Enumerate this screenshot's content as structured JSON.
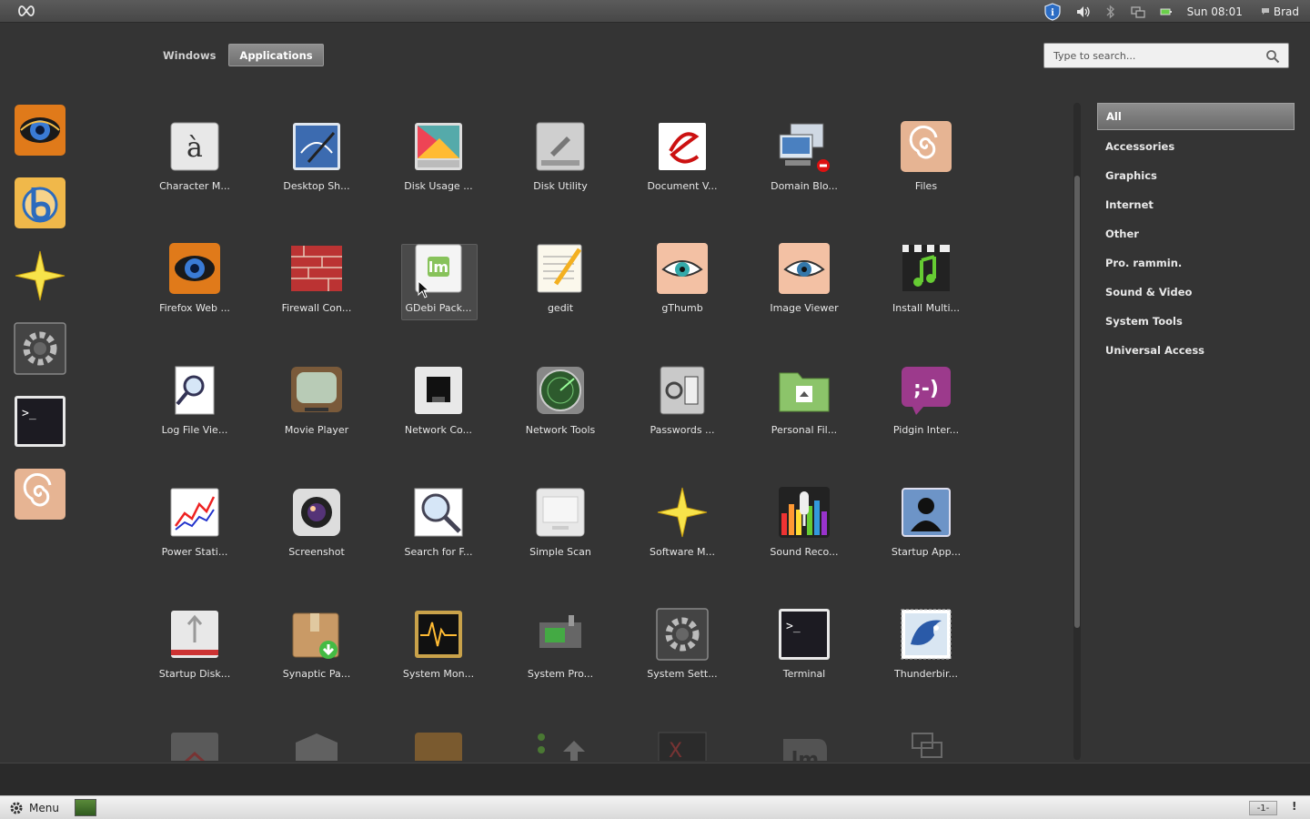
{
  "topbar": {
    "clock": "Sun 08:01",
    "user": "Brad"
  },
  "tabs": [
    {
      "label": "Windows",
      "active": false
    },
    {
      "label": "Applications",
      "active": true
    }
  ],
  "search": {
    "placeholder": "Type to search..."
  },
  "favorites": [
    "firefox-icon",
    "bittorrent-icon",
    "software-manager-icon",
    "system-settings-icon",
    "terminal-icon",
    "files-icon"
  ],
  "apps": [
    {
      "label": "Character M...",
      "icon": "character-map-icon"
    },
    {
      "label": "Desktop Sh...",
      "icon": "desktop-sharing-icon"
    },
    {
      "label": "Disk Usage ...",
      "icon": "disk-usage-icon"
    },
    {
      "label": "Disk Utility",
      "icon": "disk-utility-icon"
    },
    {
      "label": "Document V...",
      "icon": "document-viewer-icon"
    },
    {
      "label": "Domain Blo...",
      "icon": "domain-blocker-icon"
    },
    {
      "label": "Files",
      "icon": "files-icon"
    },
    {
      "label": "Firefox Web ...",
      "icon": "firefox-icon"
    },
    {
      "label": "Firewall Con...",
      "icon": "firewall-icon"
    },
    {
      "label": "GDebi Pack...",
      "icon": "gdebi-icon"
    },
    {
      "label": "gedit",
      "icon": "gedit-icon"
    },
    {
      "label": "gThumb",
      "icon": "gthumb-icon"
    },
    {
      "label": "Image Viewer",
      "icon": "image-viewer-icon"
    },
    {
      "label": "Install Multi...",
      "icon": "install-multimedia-icon"
    },
    {
      "label": "Log File Vie...",
      "icon": "log-viewer-icon"
    },
    {
      "label": "Movie Player",
      "icon": "movie-player-icon"
    },
    {
      "label": "Network Co...",
      "icon": "network-connections-icon"
    },
    {
      "label": "Network Tools",
      "icon": "network-tools-icon"
    },
    {
      "label": "Passwords ...",
      "icon": "passwords-icon"
    },
    {
      "label": "Personal Fil...",
      "icon": "personal-file-sharing-icon"
    },
    {
      "label": "Pidgin Inter...",
      "icon": "pidgin-icon"
    },
    {
      "label": "Power Stati...",
      "icon": "power-statistics-icon"
    },
    {
      "label": "Screenshot",
      "icon": "screenshot-icon"
    },
    {
      "label": "Search for F...",
      "icon": "search-files-icon"
    },
    {
      "label": "Simple Scan",
      "icon": "simple-scan-icon"
    },
    {
      "label": "Software M...",
      "icon": "software-manager-icon"
    },
    {
      "label": "Sound Reco...",
      "icon": "sound-recorder-icon"
    },
    {
      "label": "Startup App...",
      "icon": "startup-applications-icon"
    },
    {
      "label": "Startup Disk...",
      "icon": "startup-disk-icon"
    },
    {
      "label": "Synaptic Pa...",
      "icon": "synaptic-icon"
    },
    {
      "label": "System Mon...",
      "icon": "system-monitor-icon"
    },
    {
      "label": "System Pro...",
      "icon": "system-profiler-icon"
    },
    {
      "label": "System Sett...",
      "icon": "system-settings-icon"
    },
    {
      "label": "Terminal",
      "icon": "terminal-icon"
    },
    {
      "label": "Thunderbir...",
      "icon": "thunderbird-icon"
    },
    {
      "label": "",
      "icon": "update-manager-icon"
    },
    {
      "label": "",
      "icon": "users-icon"
    },
    {
      "label": "",
      "icon": "upload-manager-icon"
    },
    {
      "label": "",
      "icon": "upgrade-icon"
    },
    {
      "label": "",
      "icon": "xterm-icon"
    },
    {
      "label": "",
      "icon": "mint-welcome-icon"
    },
    {
      "label": "",
      "icon": "workspaces-icon"
    }
  ],
  "categories": [
    "All",
    "Accessories",
    "Graphics",
    "Internet",
    "Other",
    "Pro. rammin.",
    "Sound & Video",
    "System Tools",
    "Universal Access"
  ],
  "bottom": {
    "menu_label": "Menu",
    "workspace": "-1-",
    "notification": "!"
  }
}
